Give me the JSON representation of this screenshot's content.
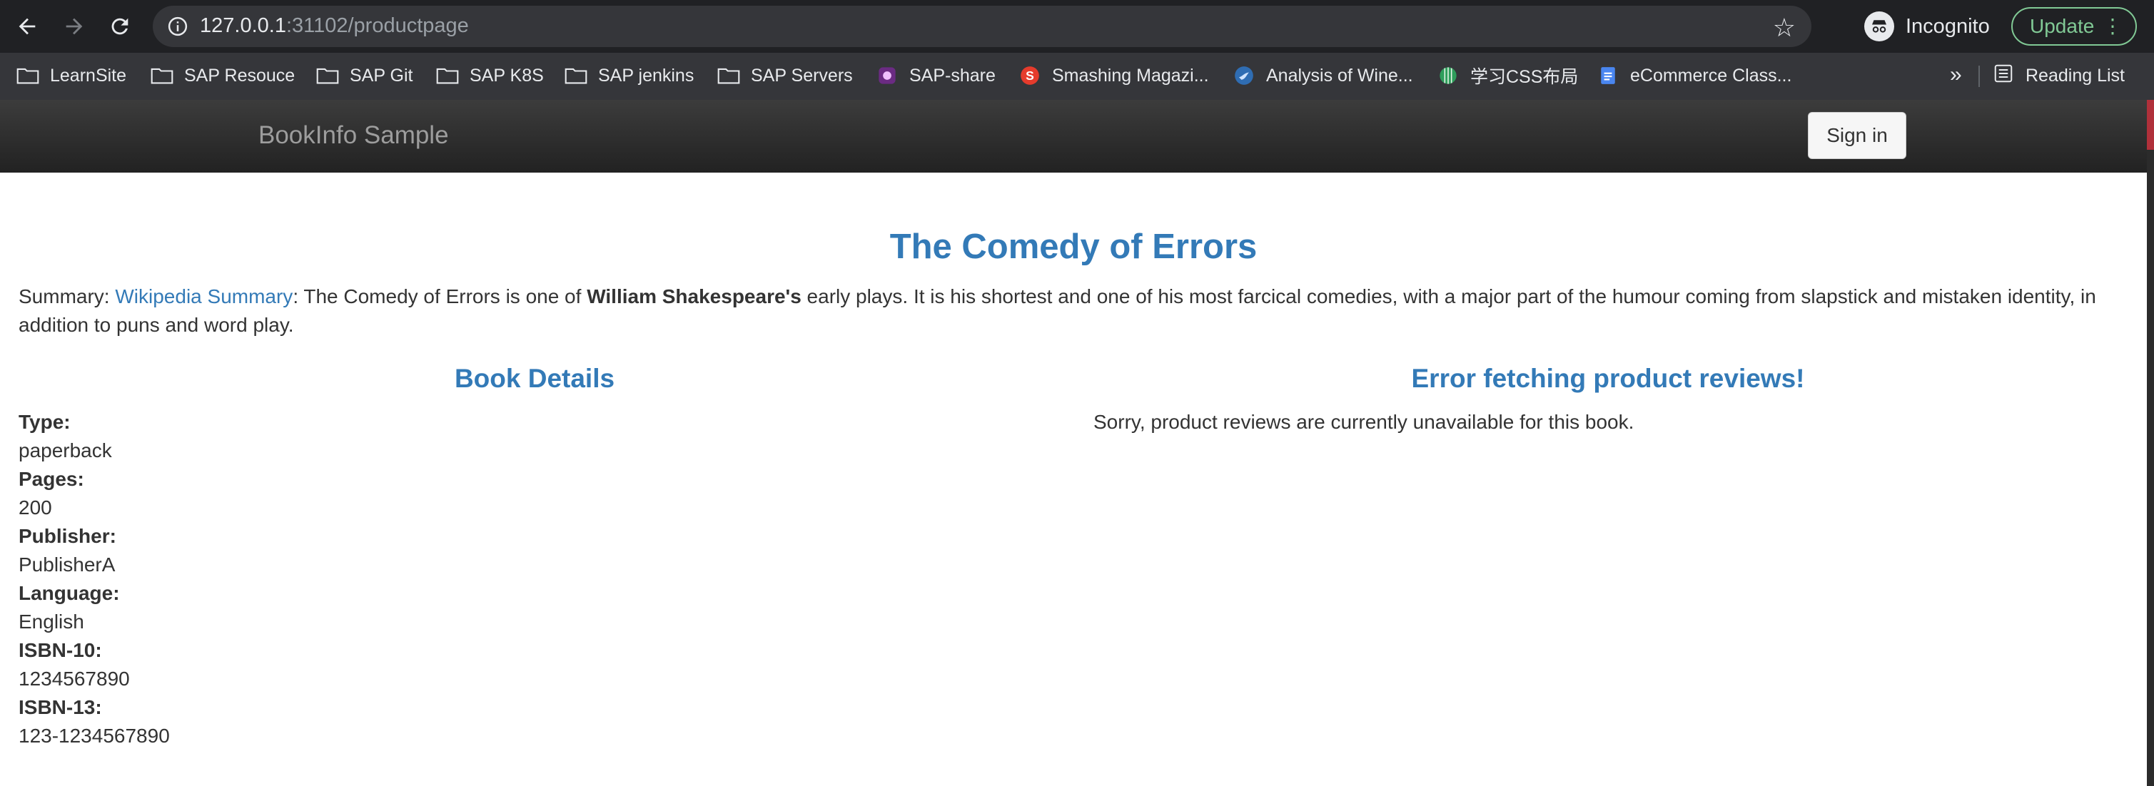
{
  "browser": {
    "url_host": "127.0.0.1",
    "url_path": ":31102/productpage",
    "profile_label": "Incognito",
    "update_label": "Update",
    "bookmarks": [
      {
        "label": "LearnSite",
        "icon": "folder-icon"
      },
      {
        "label": "SAP Resouce",
        "icon": "folder-icon"
      },
      {
        "label": "SAP Git",
        "icon": "folder-icon"
      },
      {
        "label": "SAP K8S",
        "icon": "folder-icon"
      },
      {
        "label": "SAP jenkins",
        "icon": "folder-icon"
      },
      {
        "label": "SAP Servers",
        "icon": "folder-icon"
      },
      {
        "label": "SAP-share",
        "icon": "app-icon"
      },
      {
        "label": "Smashing Magazi...",
        "icon": "smashing-icon"
      },
      {
        "label": "Analysis of Wine...",
        "icon": "bird-icon"
      },
      {
        "label": "学习CSS布局",
        "icon": "globe-icon"
      },
      {
        "label": "eCommerce Class...",
        "icon": "doc-icon"
      }
    ],
    "overflow_label": "»",
    "reading_list_label": "Reading List"
  },
  "navbar": {
    "brand": "BookInfo Sample",
    "signin_label": "Sign in"
  },
  "product": {
    "title": "The Comedy of Errors",
    "summary_prefix": "Summary: ",
    "summary_link": "Wikipedia Summary",
    "summary_text_1": ": The Comedy of Errors is one of ",
    "summary_bold": "William Shakespeare's",
    "summary_text_2": " early plays. It is his shortest and one of his most farcical comedies, with a major part of the humour coming from slapstick and mistaken identity, in addition to puns and word play."
  },
  "details": {
    "heading": "Book Details",
    "items": [
      {
        "label": "Type:",
        "value": "paperback"
      },
      {
        "label": "Pages:",
        "value": "200"
      },
      {
        "label": "Publisher:",
        "value": "PublisherA"
      },
      {
        "label": "Language:",
        "value": "English"
      },
      {
        "label": "ISBN-10:",
        "value": "1234567890"
      },
      {
        "label": "ISBN-13:",
        "value": "123-1234567890"
      }
    ]
  },
  "reviews": {
    "heading": "Error fetching product reviews!",
    "message": "Sorry, product reviews are currently unavailable for this book."
  },
  "colors": {
    "link": "#337ab7",
    "navbar": "#222222",
    "browser_toolbar": "#202124",
    "update_accent": "#81c995"
  }
}
